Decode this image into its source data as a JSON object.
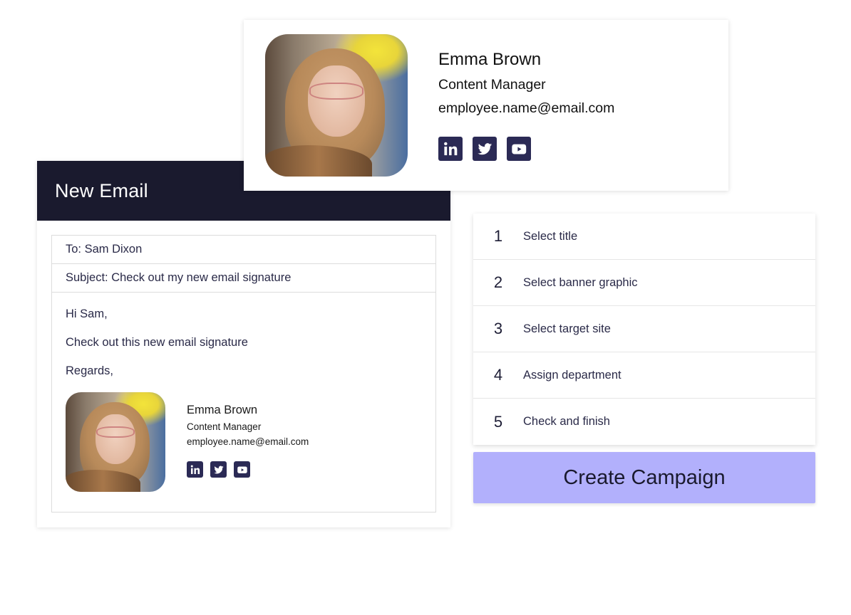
{
  "signature": {
    "name": "Emma Brown",
    "title": "Content Manager",
    "email": "employee.name@email.com",
    "photo_alt": "profile-photo",
    "socials": [
      {
        "name": "linkedin",
        "icon": "linkedin-icon"
      },
      {
        "name": "twitter",
        "icon": "twitter-icon"
      },
      {
        "name": "youtube",
        "icon": "youtube-icon"
      }
    ]
  },
  "email": {
    "window_title": "New Email",
    "to": "To: Sam Dixon",
    "subject": "Subject: Check out my new email signature",
    "body": {
      "greeting": "Hi Sam,",
      "line": "Check out this new email signature",
      "closing": "Regards,"
    }
  },
  "steps": [
    {
      "number": "1",
      "label": "Select title"
    },
    {
      "number": "2",
      "label": "Select banner graphic"
    },
    {
      "number": "3",
      "label": "Select target site"
    },
    {
      "number": "4",
      "label": "Assign department"
    },
    {
      "number": "5",
      "label": "Check and finish"
    }
  ],
  "cta": {
    "label": "Create Campaign",
    "color": "#b2b0fc"
  },
  "colors": {
    "header_bg": "#1a1a2e",
    "social_icon_bg": "#2b2a55"
  }
}
